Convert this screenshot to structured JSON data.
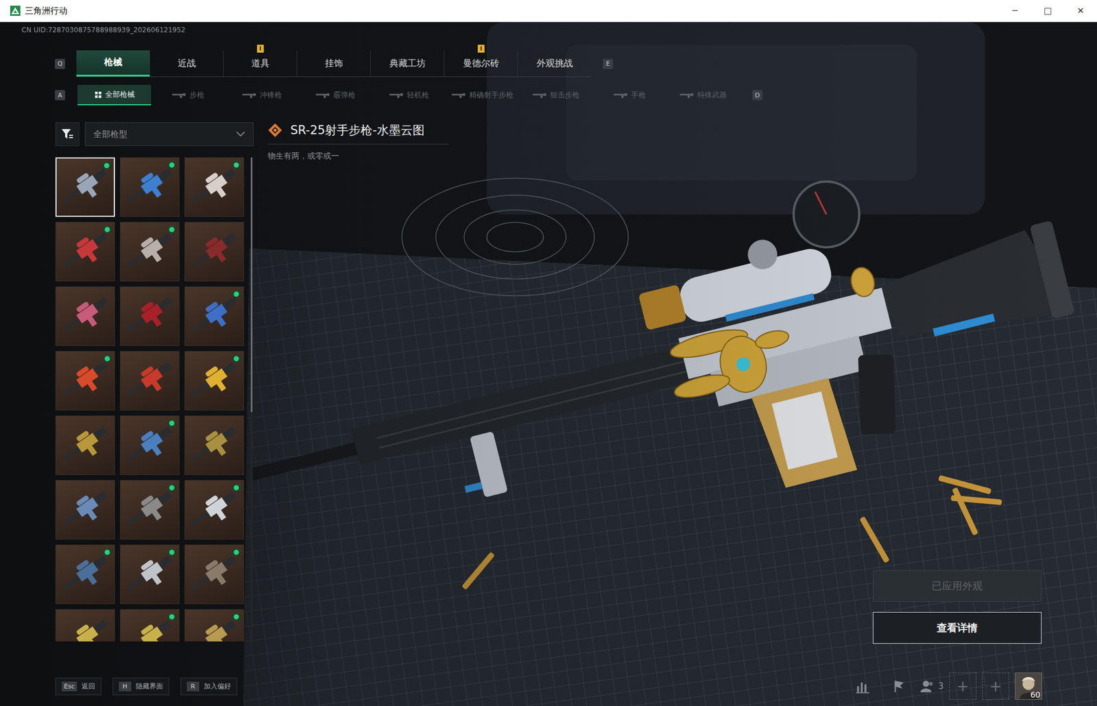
{
  "window": {
    "title": "三角洲行动",
    "controls": [
      "─",
      "□",
      "✕"
    ]
  },
  "uid": "CN UID:7287030875788988939_202606121952",
  "tabs": {
    "prev_key": "Q",
    "next_key": "E",
    "items": [
      {
        "label": "枪械",
        "selected": true,
        "badge": false
      },
      {
        "label": "近战",
        "selected": false,
        "badge": false
      },
      {
        "label": "道具",
        "selected": false,
        "badge": true
      },
      {
        "label": "挂饰",
        "selected": false,
        "badge": false
      },
      {
        "label": "典藏工坊",
        "selected": false,
        "badge": false
      },
      {
        "label": "曼德尔砖",
        "selected": false,
        "badge": true
      },
      {
        "label": "外观挑战",
        "selected": false,
        "badge": false
      }
    ]
  },
  "subtabs": {
    "prev_key": "A",
    "next_key": "D",
    "items": [
      {
        "label": "全部枪械",
        "selected": true
      },
      {
        "label": "步枪",
        "selected": false
      },
      {
        "label": "冲锋枪",
        "selected": false
      },
      {
        "label": "霰弹枪",
        "selected": false
      },
      {
        "label": "轻机枪",
        "selected": false
      },
      {
        "label": "精确射手步枪",
        "selected": false
      },
      {
        "label": "狙击步枪",
        "selected": false
      },
      {
        "label": "手枪",
        "selected": false
      },
      {
        "label": "特殊武器",
        "selected": false
      }
    ]
  },
  "filter": {
    "value": "全部枪型"
  },
  "skins": [
    {
      "selected": true,
      "equipped": true,
      "color": "#9aa6b8"
    },
    {
      "selected": false,
      "equipped": true,
      "color": "#3d7fd1"
    },
    {
      "selected": false,
      "equipped": true,
      "color": "#d8d0c8"
    },
    {
      "selected": false,
      "equipped": true,
      "color": "#c8383a"
    },
    {
      "selected": false,
      "equipped": true,
      "color": "#b8b0a8"
    },
    {
      "selected": false,
      "equipped": false,
      "color": "#8a2a2a"
    },
    {
      "selected": false,
      "equipped": false,
      "color": "#c85a7a"
    },
    {
      "selected": false,
      "equipped": false,
      "color": "#a8202a"
    },
    {
      "selected": false,
      "equipped": true,
      "color": "#3d6fc8"
    },
    {
      "selected": false,
      "equipped": true,
      "color": "#d84a2a"
    },
    {
      "selected": false,
      "equipped": false,
      "color": "#c83a2a"
    },
    {
      "selected": false,
      "equipped": true,
      "color": "#e0b030"
    },
    {
      "selected": false,
      "equipped": false,
      "color": "#b8983a"
    },
    {
      "selected": false,
      "equipped": true,
      "color": "#4a7fc0"
    },
    {
      "selected": false,
      "equipped": false,
      "color": "#a89040"
    },
    {
      "selected": false,
      "equipped": false,
      "color": "#6a8ab8"
    },
    {
      "selected": false,
      "equipped": true,
      "color": "#8a8a8a"
    },
    {
      "selected": false,
      "equipped": true,
      "color": "#d0d4d8"
    },
    {
      "selected": false,
      "equipped": true,
      "color": "#4a6f9a"
    },
    {
      "selected": false,
      "equipped": true,
      "color": "#c0c4c8"
    },
    {
      "selected": false,
      "equipped": true,
      "color": "#8a7a6a"
    },
    {
      "selected": false,
      "equipped": false,
      "color": "#c8b04a"
    },
    {
      "selected": false,
      "equipped": true,
      "color": "#c8b04a"
    },
    {
      "selected": false,
      "equipped": true,
      "color": "#b89a50"
    }
  ],
  "detail": {
    "name": "SR-25射手步枪-水墨云图",
    "motto": "物生有两，或零或一"
  },
  "buttons": [
    {
      "label": "已应用外观",
      "disabled": true
    },
    {
      "label": "查看详情",
      "disabled": false
    }
  ],
  "hints": [
    {
      "key": "Esc",
      "label": "返回"
    },
    {
      "key": "H",
      "label": "隐藏界面"
    },
    {
      "key": "R",
      "label": "加入偏好"
    }
  ],
  "social": {
    "friends": "3",
    "slots": [
      "+",
      "+"
    ],
    "level": "60"
  }
}
